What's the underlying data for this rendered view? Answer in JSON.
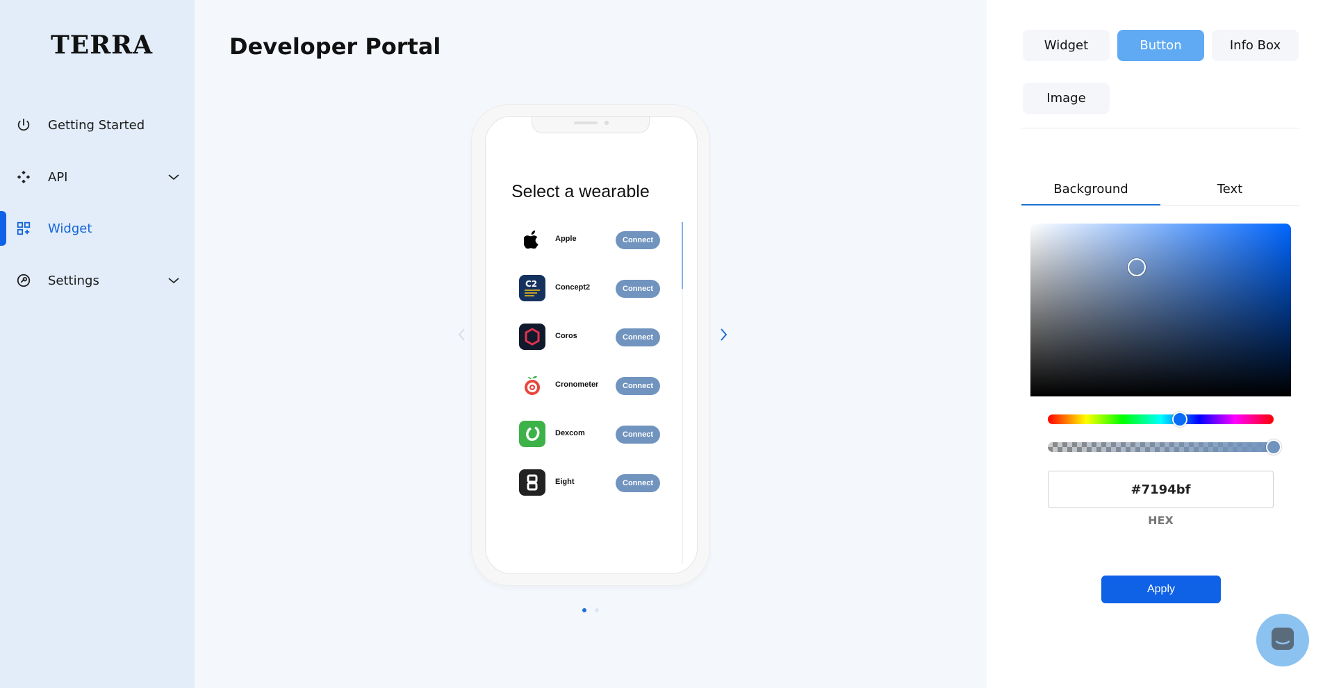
{
  "brand": {
    "logo_text": "TERRA"
  },
  "sidebar": {
    "items": [
      {
        "label": "Getting Started",
        "icon": "power-icon"
      },
      {
        "label": "API",
        "icon": "api-icon",
        "expandable": true
      },
      {
        "label": "Widget",
        "icon": "widget-grid-icon",
        "active": true
      },
      {
        "label": "Settings",
        "icon": "settings-icon",
        "expandable": true
      }
    ]
  },
  "main": {
    "title": "Developer Portal",
    "preview": {
      "heading": "Select a wearable",
      "providers": [
        {
          "name": "Apple",
          "button": "Connect",
          "icon": "apple-logo"
        },
        {
          "name": "Concept2",
          "button": "Connect",
          "icon": "concept2-logo"
        },
        {
          "name": "Coros",
          "button": "Connect",
          "icon": "coros-logo"
        },
        {
          "name": "Cronometer",
          "button": "Connect",
          "icon": "cronometer-logo"
        },
        {
          "name": "Dexcom",
          "button": "Connect",
          "icon": "dexcom-logo"
        },
        {
          "name": "Eight",
          "button": "Connect",
          "icon": "eight-logo"
        }
      ],
      "carousel_pages": 2,
      "carousel_active_page": 1
    }
  },
  "panel": {
    "segments": [
      "Widget",
      "Button",
      "Info Box",
      "Image"
    ],
    "selected_segment": "Button",
    "subtabs": [
      "Background",
      "Text"
    ],
    "active_subtab": "Background",
    "color_picker": {
      "hex_value": "#7194bf",
      "hex_label": "HEX",
      "hue_color": "#0066ff",
      "alpha": 1.0
    },
    "apply_label": "Apply"
  },
  "colors": {
    "accent": "#0f62e6",
    "segment_selected": "#60aaf4",
    "connect_button": "#7194bf",
    "sidebar_bg": "#e2edf9"
  }
}
